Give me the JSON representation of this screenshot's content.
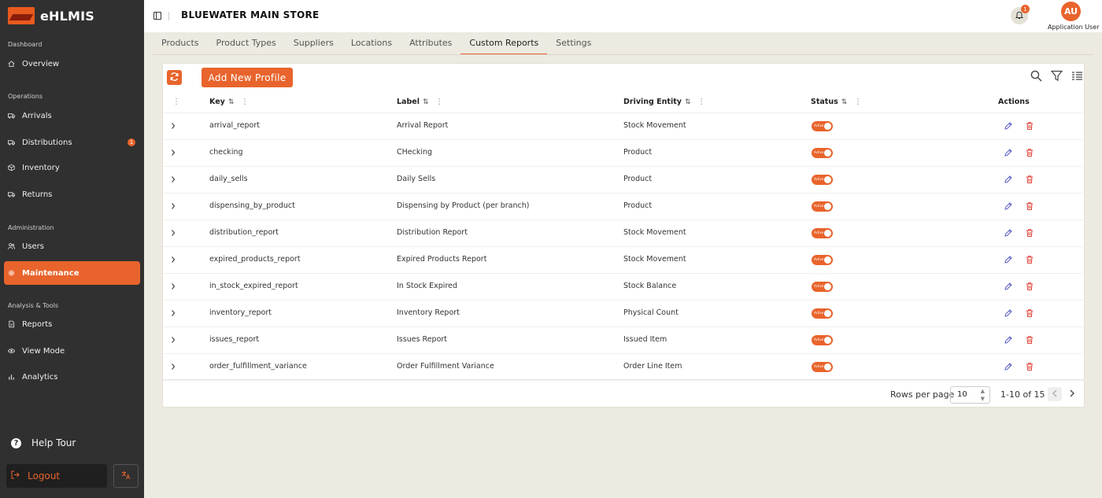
{
  "app": {
    "name": "eHLMIS"
  },
  "sidebar": {
    "sections": {
      "dashboard": "Dashboard",
      "operations": "Operations",
      "administration": "Administration",
      "analysis": "Analysis & Tools"
    },
    "items": {
      "overview": "Overview",
      "arrivals": "Arrivals",
      "distributions": "Distributions",
      "distributions_badge": "1",
      "inventory": "Inventory",
      "returns": "Returns",
      "users": "Users",
      "maintenance": "Maintenance",
      "reports": "Reports",
      "view_mode": "View Mode",
      "analytics": "Analytics"
    },
    "help_tour": "Help Tour",
    "logout": "Logout"
  },
  "header": {
    "store_name": "BLUEWATER MAIN STORE",
    "notification_count": "1",
    "avatar_initials": "AU",
    "user_name": "Application User"
  },
  "tabs": [
    "Products",
    "Product Types",
    "Suppliers",
    "Locations",
    "Attributes",
    "Custom Reports",
    "Settings"
  ],
  "toolbar": {
    "add_label": "Add New Profile"
  },
  "table": {
    "columns": {
      "key": "Key",
      "label": "Label",
      "entity": "Driving Entity",
      "status": "Status",
      "actions": "Actions"
    },
    "status_text": "Active",
    "rows": [
      {
        "key": "arrival_report",
        "label": "Arrival Report",
        "entity": "Stock Movement"
      },
      {
        "key": "checking",
        "label": "CHecking",
        "entity": "Product"
      },
      {
        "key": "daily_sells",
        "label": "Daily Sells",
        "entity": "Product"
      },
      {
        "key": "dispensing_by_product",
        "label": "Dispensing by Product (per branch)",
        "entity": "Product"
      },
      {
        "key": "distribution_report",
        "label": "Distribution Report",
        "entity": "Stock Movement"
      },
      {
        "key": "expired_products_report",
        "label": "Expired Products Report",
        "entity": "Stock Movement"
      },
      {
        "key": "in_stock_expired_report",
        "label": "In Stock Expired",
        "entity": "Stock Balance"
      },
      {
        "key": "inventory_report",
        "label": "Inventory Report",
        "entity": "Physical Count"
      },
      {
        "key": "issues_report",
        "label": "Issues Report",
        "entity": "Issued Item"
      },
      {
        "key": "order_fulfillment_variance",
        "label": "Order Fulfillment Variance",
        "entity": "Order Line Item"
      }
    ]
  },
  "pagination": {
    "rows_per_page_label": "Rows per page",
    "rows_per_page": "10",
    "range": "1-10 of 15"
  },
  "colors": {
    "accent": "#e8642c",
    "sidebar_bg": "#303030",
    "page_bg": "#eceae1"
  }
}
